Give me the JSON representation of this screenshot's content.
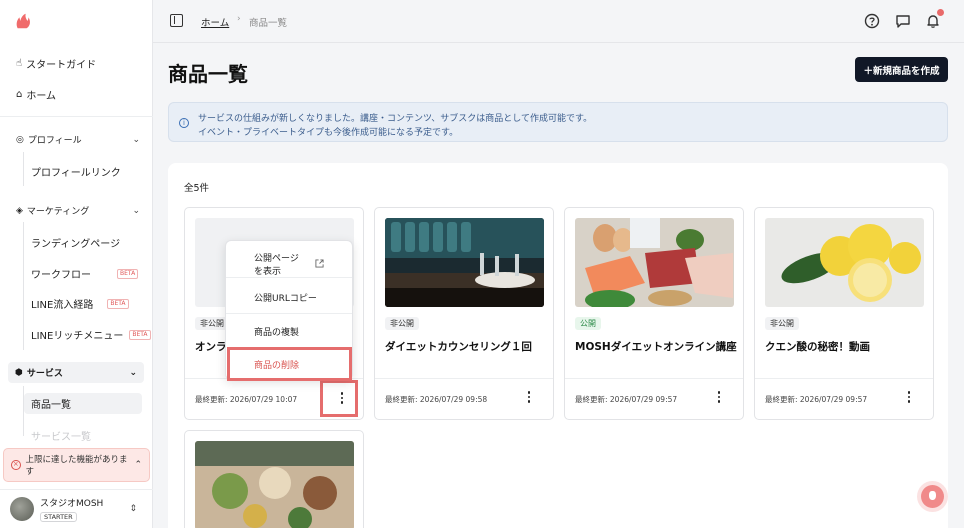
{
  "colors": {
    "brand": "#f06b6b",
    "primary_button": "#111827",
    "public_badge": "#2b8a47",
    "delete_text": "#d9534f",
    "highlight": "#e56d6d"
  },
  "sidebar": {
    "start_guide": "スタートガイド",
    "home": "ホーム",
    "profile": {
      "label": "プロフィール",
      "items": [
        "プロフィールリンク"
      ]
    },
    "marketing": {
      "label": "マーケティング",
      "items": [
        {
          "label": "ランディングページ",
          "badge": ""
        },
        {
          "label": "ワークフロー",
          "badge": "BETA"
        },
        {
          "label": "LINE流入経路",
          "badge": "BETA"
        },
        {
          "label": "LINEリッチメニュー",
          "badge": "BETA"
        }
      ]
    },
    "service": {
      "label": "サービス",
      "items": [
        "商品一覧",
        "サービス一覧"
      ]
    },
    "limit_notice": "上限に達した機能があります",
    "account": {
      "name": "スタジオMOSH",
      "plan": "STARTER"
    }
  },
  "topbar": {
    "breadcrumb": {
      "home": "ホーム",
      "separator": "›",
      "current": "商品一覧"
    },
    "icons": [
      "help-icon",
      "chat-icon",
      "bell-icon"
    ]
  },
  "main": {
    "title": "商品一覧",
    "create_button": "＋新規商品を作成",
    "info": {
      "line1": "サービスの仕組みが新しくなりました。講座・コンテンツ、サブスクは商品として作成可能です。",
      "line2": "イベント・プライベートタイプも今後作成可能になる予定です。"
    },
    "count": "全5件",
    "products": [
      {
        "status": "非公開",
        "title": "オンラ",
        "updated": "最終更新: 2026/07/29 10:07"
      },
      {
        "status": "非公開",
        "title": "ダイエットカウンセリング１回",
        "updated": "最終更新: 2026/07/29 09:58"
      },
      {
        "status": "公開",
        "title": "MOSHダイエットオンライン講座",
        "updated": "最終更新: 2026/07/29 09:57"
      },
      {
        "status": "非公開",
        "title": "クエン酸の秘密！動画",
        "updated": "最終更新: 2026/07/29 09:57"
      },
      {
        "status": "",
        "title": "",
        "updated": ""
      }
    ]
  },
  "menu": {
    "view_public_line1": "公開ページ",
    "view_public_line2": "を表示",
    "copy_url": "公開URLコピー",
    "duplicate": "商品の複製",
    "delete": "商品の削除"
  }
}
